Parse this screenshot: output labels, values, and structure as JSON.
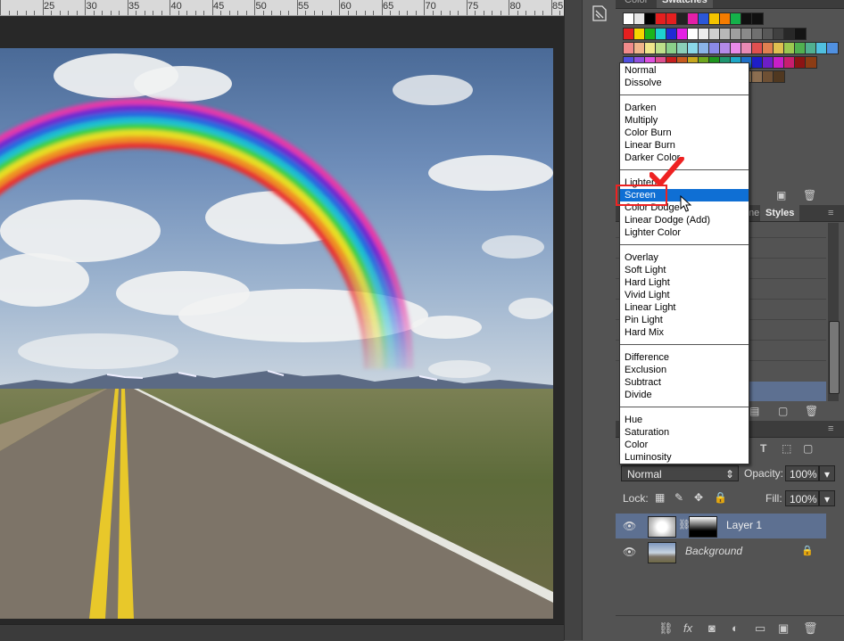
{
  "ruler": {
    "labels": [
      "25",
      "30",
      "35",
      "40",
      "45",
      "50",
      "55",
      "60",
      "65",
      "70",
      "75",
      "80",
      "85"
    ]
  },
  "panels": {
    "color_tab": "Color",
    "swatches_tab": "Swatches",
    "adjust_tabs": {
      "name_partial": "me",
      "styles": "Styles"
    },
    "swatch_colors": [
      [
        "#ffffff",
        "#e6e6e6",
        "#000000",
        "#e41f1f",
        "#e41f1f",
        "#222222",
        "#e41fa8",
        "#2b57d8",
        "#f5c400",
        "#f57c00",
        "#14b14a",
        "#101010",
        "#101010"
      ],
      [
        "#e41f1f",
        "#f5d400",
        "#1bb41b",
        "#1ed0d0",
        "#1f2ad4",
        "#e41fe4",
        "#ffffff",
        "#ededed",
        "#d0d0d0",
        "#b8b8b8",
        "#a0a0a0",
        "#8a8a8a",
        "#707070",
        "#585858",
        "#404040",
        "#282828",
        "#141414"
      ],
      [
        "#f08a8a",
        "#f0b48a",
        "#f0e68a",
        "#bde08a",
        "#8ad08a",
        "#8ad0b8",
        "#8ad8e8",
        "#8ab4e8",
        "#8a8ae8",
        "#b48ae8",
        "#e88ae8",
        "#e88ab4",
        "#e05050",
        "#e08050",
        "#e0c050",
        "#9cc850",
        "#50b050",
        "#50b090",
        "#50c0e0",
        "#5090e0"
      ],
      [
        "#5050e0",
        "#9050e0",
        "#e050e0",
        "#e05090",
        "#c81e1e",
        "#c85a1e",
        "#c8a81e",
        "#6ea81e",
        "#1e961e",
        "#1e9670",
        "#1ea8c8",
        "#1e6ec8",
        "#1e1ec8",
        "#6e1ec8",
        "#c81ec8",
        "#c81e6e",
        "#8c1414",
        "#8c3c14"
      ],
      [
        "#8c7814",
        "#4c7814",
        "#146414",
        "#14644c",
        "#14788c",
        "#144c8c",
        "#14148c",
        "#4c148c",
        "#8c148c",
        "#8c144c",
        "#c8a882",
        "#a88a64",
        "#8c6e50",
        "#6e5034",
        "#503820"
      ]
    ]
  },
  "blend_modes": {
    "groups": [
      [
        "Normal",
        "Dissolve"
      ],
      [
        "Darken",
        "Multiply",
        "Color Burn",
        "Linear Burn",
        "Darker Color"
      ],
      [
        "Lighten",
        "Screen",
        "Color Dodge",
        "Linear Dodge (Add)",
        "Lighter Color"
      ],
      [
        "Overlay",
        "Soft Light",
        "Hard Light",
        "Vivid Light",
        "Linear Light",
        "Pin Light",
        "Hard Mix"
      ],
      [
        "Difference",
        "Exclusion",
        "Subtract",
        "Divide"
      ],
      [
        "Hue",
        "Saturation",
        "Color",
        "Luminosity"
      ]
    ],
    "selected": "Screen"
  },
  "layers_panel": {
    "blend_mode_value": "Normal",
    "opacity_label": "Opacity:",
    "opacity_value": "100%",
    "lock_label": "Lock:",
    "fill_label": "Fill:",
    "fill_value": "100%",
    "layers": [
      {
        "name": "Layer 1",
        "selected": true
      },
      {
        "name": "Background",
        "selected": false
      }
    ]
  },
  "colors": {
    "accent": "#0f6fd4",
    "highlight_box": "#e22222",
    "selected_layer": "#5d7091"
  }
}
